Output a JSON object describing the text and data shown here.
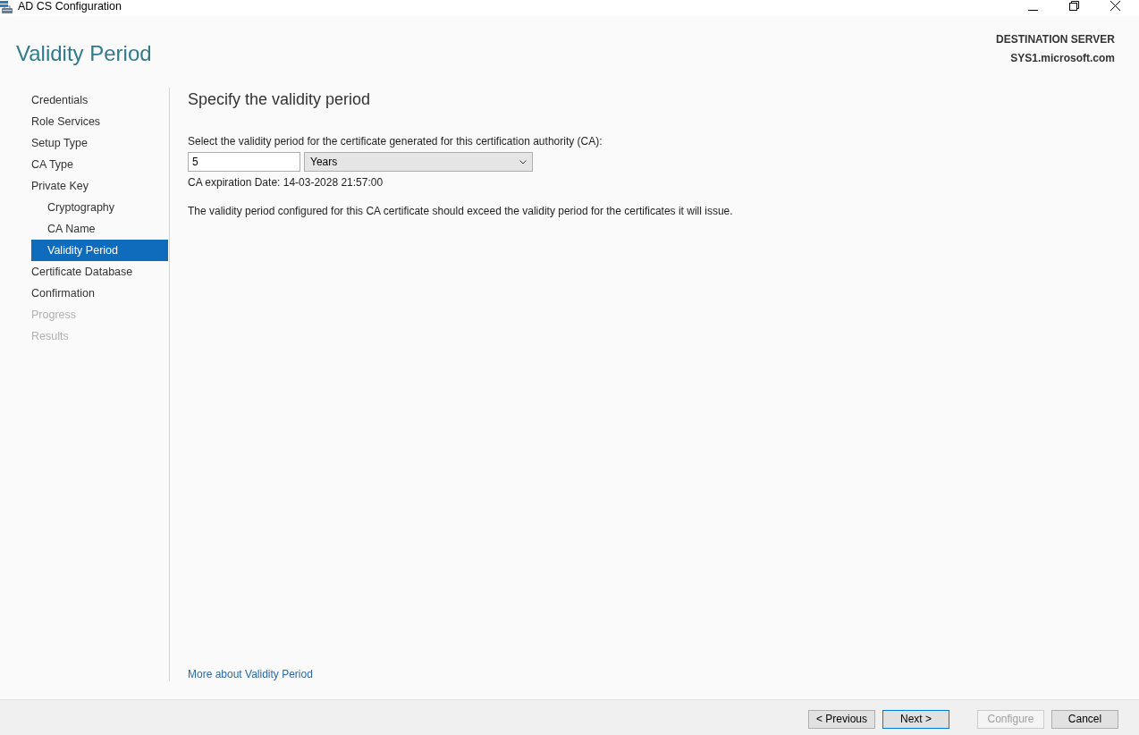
{
  "window": {
    "title": "AD CS Configuration"
  },
  "page_title": "Validity Period",
  "destination_server": {
    "label": "DESTINATION SERVER",
    "value": "SYS1.microsoft.com"
  },
  "sidebar": {
    "items": [
      {
        "label": "Credentials",
        "selected": false,
        "disabled": false
      },
      {
        "label": "Role Services",
        "selected": false,
        "disabled": false
      },
      {
        "label": "Setup Type",
        "selected": false,
        "disabled": false
      },
      {
        "label": "CA Type",
        "selected": false,
        "disabled": false
      },
      {
        "label": "Private Key",
        "selected": false,
        "disabled": false,
        "children": [
          {
            "label": "Cryptography",
            "selected": false,
            "disabled": false
          },
          {
            "label": "CA Name",
            "selected": false,
            "disabled": false
          },
          {
            "label": "Validity Period",
            "selected": true,
            "disabled": false
          }
        ]
      },
      {
        "label": "Certificate Database",
        "selected": false,
        "disabled": false
      },
      {
        "label": "Confirmation",
        "selected": false,
        "disabled": false
      },
      {
        "label": "Progress",
        "selected": false,
        "disabled": true
      },
      {
        "label": "Results",
        "selected": false,
        "disabled": true
      }
    ]
  },
  "content": {
    "heading": "Specify the validity period",
    "prompt": "Select the validity period for the certificate generated for this certification authority (CA):",
    "period_value": "5",
    "period_unit": "Years",
    "expiration": "CA expiration Date: 14-03-2028 21:57:00",
    "note": "The validity period configured for this CA certificate should exceed the validity period for the certificates it will issue.",
    "help_link": "More about Validity Period"
  },
  "buttons": [
    {
      "label": "< Previous",
      "disabled": false,
      "focused": false
    },
    {
      "label": "Next >",
      "disabled": false,
      "focused": true
    },
    {
      "label": "Configure",
      "disabled": true,
      "focused": false
    },
    {
      "label": "Cancel",
      "disabled": false,
      "focused": false
    }
  ]
}
